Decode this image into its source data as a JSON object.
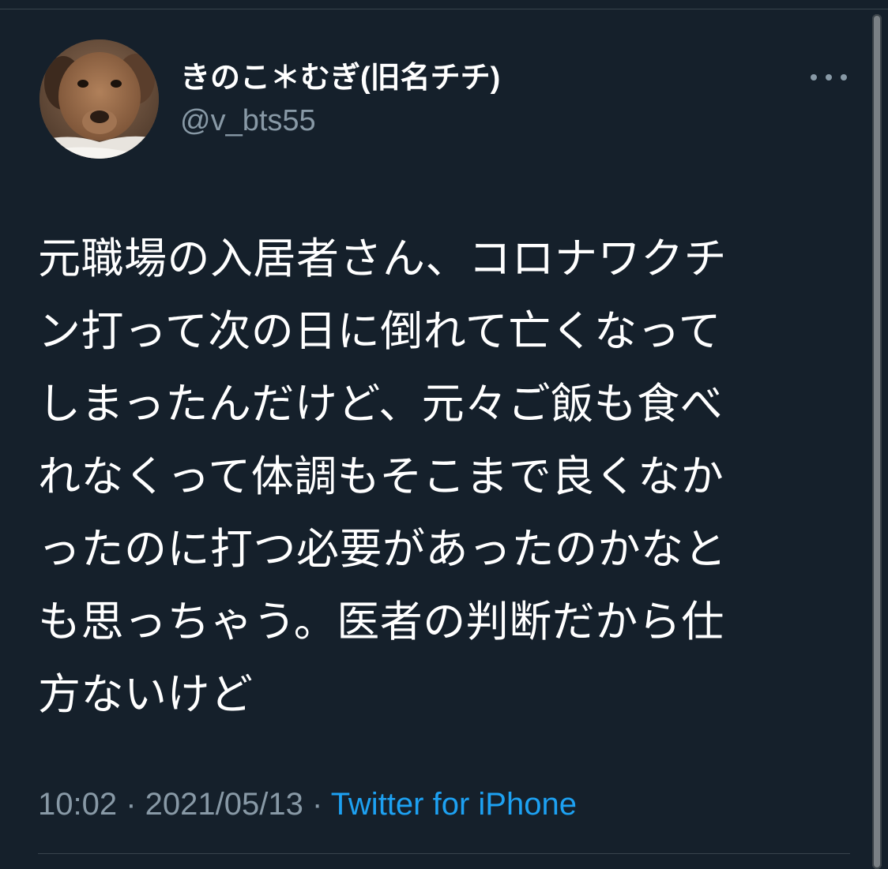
{
  "tweet": {
    "author": {
      "display_name": "きのこ＊むぎ(旧名チチ)",
      "handle": "@v_bts55",
      "avatar_icon": "dog-avatar-icon"
    },
    "more_icon": "more-horizontal-icon",
    "text_lines": [
      "元職場の入居者さん、コロナワクチ",
      "ン打って次の日に倒れて亡くなって",
      "しまったんだけど、元々ご飯も食べ",
      "れなくって体調もそこまで良くなか",
      "ったのに打つ必要があったのかなと",
      "も思っちゃう。医者の判断だから仕",
      "方ないけど"
    ],
    "time": "10:02",
    "separator": " · ",
    "date": "2021/05/13",
    "source": "Twitter for iPhone"
  },
  "colors": {
    "background": "#15202b",
    "primary_text": "#ffffff",
    "secondary_text": "#8899a6",
    "accent": "#1da1f2",
    "divider": "#38444d"
  }
}
